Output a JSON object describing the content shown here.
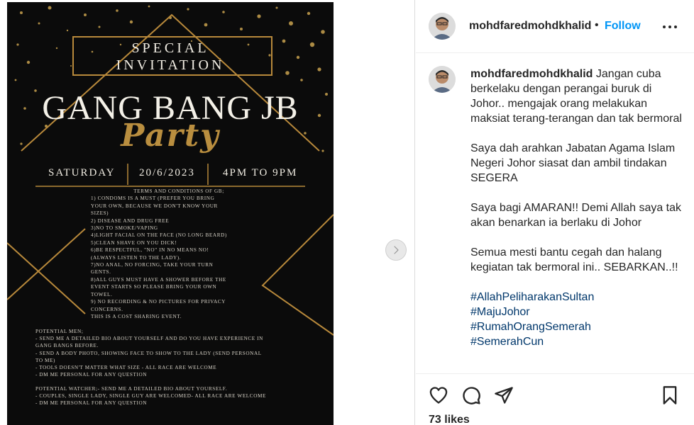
{
  "poster": {
    "special_line1": "SPECIAL",
    "special_line2": "INVITATION",
    "title": "GANG BANG JB",
    "party": "Party",
    "day": "SATURDAY",
    "date": "20/6/2023",
    "time": "4PM TO 9PM",
    "terms_head": "TERMS AND CONDITIONS OF GB;",
    "terms": [
      "1) CONDOMS IS A MUST (PREFER YOU BRING",
      "YOUR OWN, BECAUSE WE DON'T KNOW YOUR",
      "SIZES)",
      "2) DISEASE AND DRUG FREE",
      "3)NO TO SMOKE/VAPING",
      "4)LIGHT FACIAL ON THE FACE (NO LONG BEARD)",
      "5)CLEAN SHAVE ON YOU DICK!",
      "6)BE RESPECTFUL, \"NO\" IN NO MEANS NO!",
      "(ALWAYS LISTEN TO THE LADY).",
      "7)NO ANAL, NO FORCING, TAKE YOUR TURN",
      "GENTS.",
      "8)ALL GUYS MUST HAVE A SHOWER BEFORE THE",
      "EVENT STARTS SO PLEASE BRING YOUR OWN",
      "TOWEL.",
      "9) NO RECORDING & NO PICTURES FOR PRIVACY",
      "CONCERNS.",
      "THIS IS A COST SHARING EVENT."
    ],
    "potential_men": [
      "POTENTIAL MEN;",
      "- SEND ME A DETAILED BIO ABOUT YOURSELF AND DO YOU HAVE EXPERIENCE IN",
      "GANG BANGS BEFORE.",
      "- SEND A BODY PHOTO, SHOWING FACE TO SHOW TO THE LADY (SEND PERSONAL",
      "TO ME)",
      "- TOOLS DOESN'T MATTER WHAT SIZE - ALL RACE ARE WELCOME",
      "- DM ME PERSONAL FOR ANY QUESTION"
    ],
    "potential_watcher": [
      "POTENTIAL WATCHER;- SEND ME A DETAILED BIO ABOUT YOURSELF.",
      "- COUPLES, SINGLE LADY, SINGLE GUY ARE WELCOMED- ALL RACE ARE WELCOME",
      "- DM ME PERSONAL FOR ANY QUESTION"
    ]
  },
  "header": {
    "username": "mohdfaredmohdkhalid",
    "dot": "•",
    "follow": "Follow"
  },
  "caption": {
    "username": "mohdfaredmohdkhalid",
    "para1": "Jangan cuba berkelaku dengan perangai buruk di Johor.. mengajak orang melakukan maksiat terang-terangan dan tak bermoral",
    "para2": "Saya dah arahkan Jabatan Agama Islam Negeri Johor siasat dan ambil tindakan SEGERA",
    "para3": "Saya bagi AMARAN!! Demi Allah saya tak akan benarkan ia berlaku di Johor",
    "para4": "Semua mesti bantu cegah dan halang kegiatan tak bermoral ini.. SEBARKAN..!!",
    "hashtags": [
      "#AllahPeliharakanSultan",
      "#MajuJohor",
      "#RumahOrangSemerah",
      "#SemerahCun"
    ]
  },
  "footer": {
    "likes": "73 likes"
  },
  "colors": {
    "accent_blue": "#0095f6",
    "hashtag": "#00376b",
    "gold": "#b8893b"
  },
  "icons": [
    "chevron-right-icon",
    "more-horizontal-icon",
    "heart-icon",
    "comment-icon",
    "share-icon",
    "bookmark-icon"
  ]
}
